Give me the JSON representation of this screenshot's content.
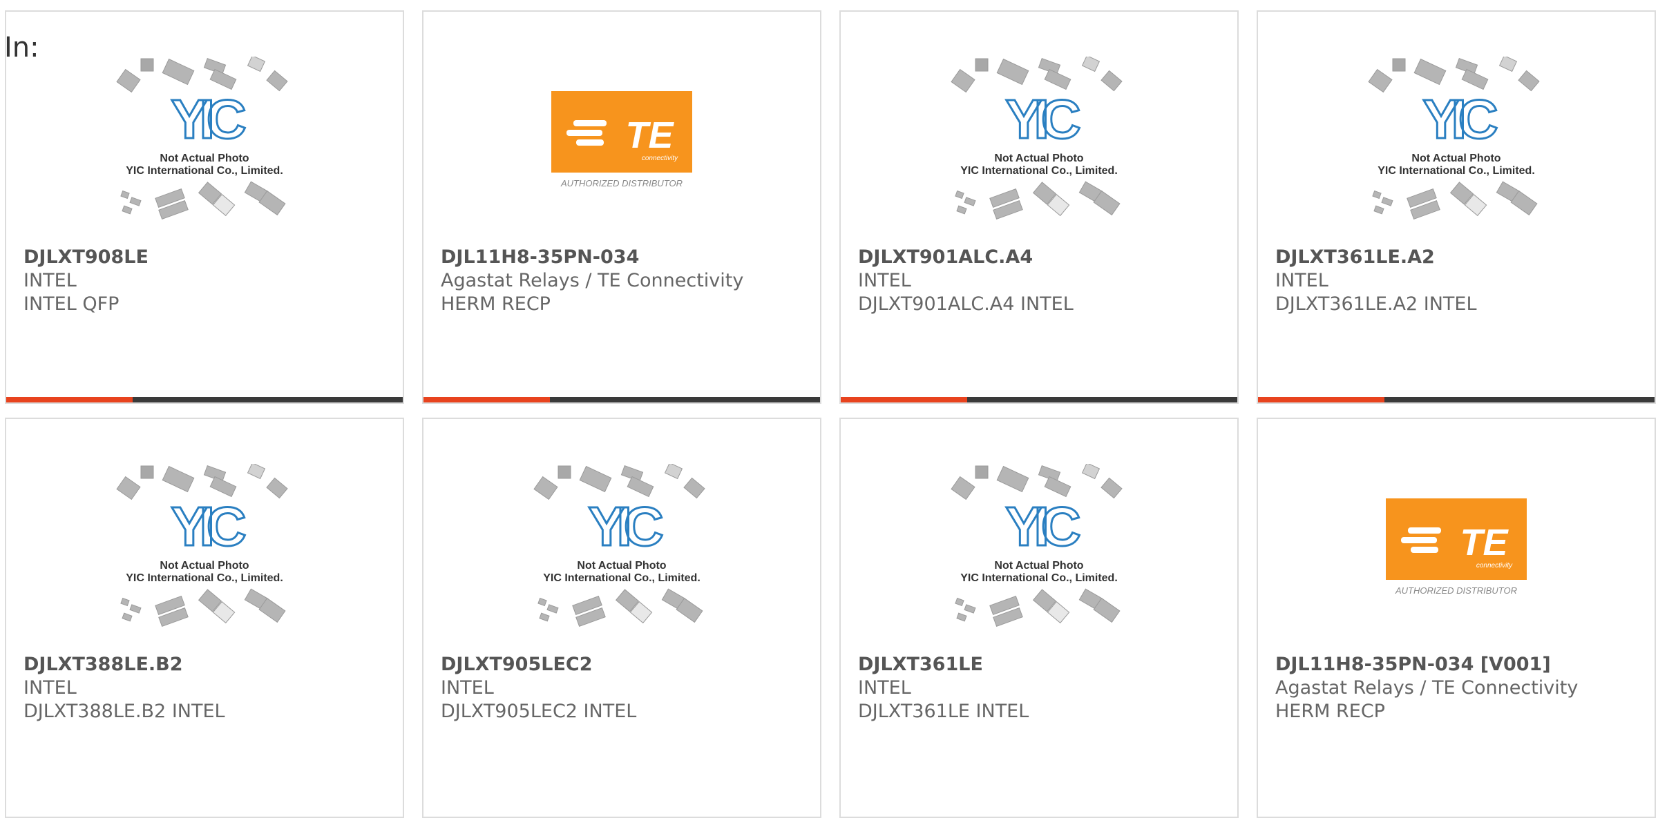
{
  "filter_label": "In:",
  "accent_color": "#e8431e",
  "bar_color": "#3a3a3a",
  "placeholder_caption": [
    "Not Actual Photo",
    "YIC International Co., Limited."
  ],
  "te_logo": {
    "text": "TE",
    "sub": "connectivity",
    "tagline": "AUTHORIZED DISTRIBUTOR",
    "color": "#f7941d"
  },
  "products": [
    {
      "part": "DJLXT908LE",
      "manufacturer": "INTEL",
      "description": "INTEL QFP",
      "image": "yic-placeholder"
    },
    {
      "part": "DJL11H8-35PN-034",
      "manufacturer": "Agastat Relays / TE Connectivity",
      "description": "HERM RECP",
      "image": "te-logo"
    },
    {
      "part": "DJLXT901ALC.A4",
      "manufacturer": "INTEL",
      "description": "DJLXT901ALC.A4 INTEL",
      "image": "yic-placeholder"
    },
    {
      "part": "DJLXT361LE.A2",
      "manufacturer": "INTEL",
      "description": "DJLXT361LE.A2 INTEL",
      "image": "yic-placeholder"
    },
    {
      "part": "DJLXT388LE.B2",
      "manufacturer": "INTEL",
      "description": "DJLXT388LE.B2 INTEL",
      "image": "yic-placeholder"
    },
    {
      "part": "DJLXT905LEC2",
      "manufacturer": "INTEL",
      "description": "DJLXT905LEC2 INTEL",
      "image": "yic-placeholder"
    },
    {
      "part": "DJLXT361LE",
      "manufacturer": "INTEL",
      "description": "DJLXT361LE INTEL",
      "image": "yic-placeholder"
    },
    {
      "part": "DJL11H8-35PN-034 [V001]",
      "manufacturer": "Agastat Relays / TE Connectivity",
      "description": "HERM RECP",
      "image": "te-logo"
    }
  ]
}
